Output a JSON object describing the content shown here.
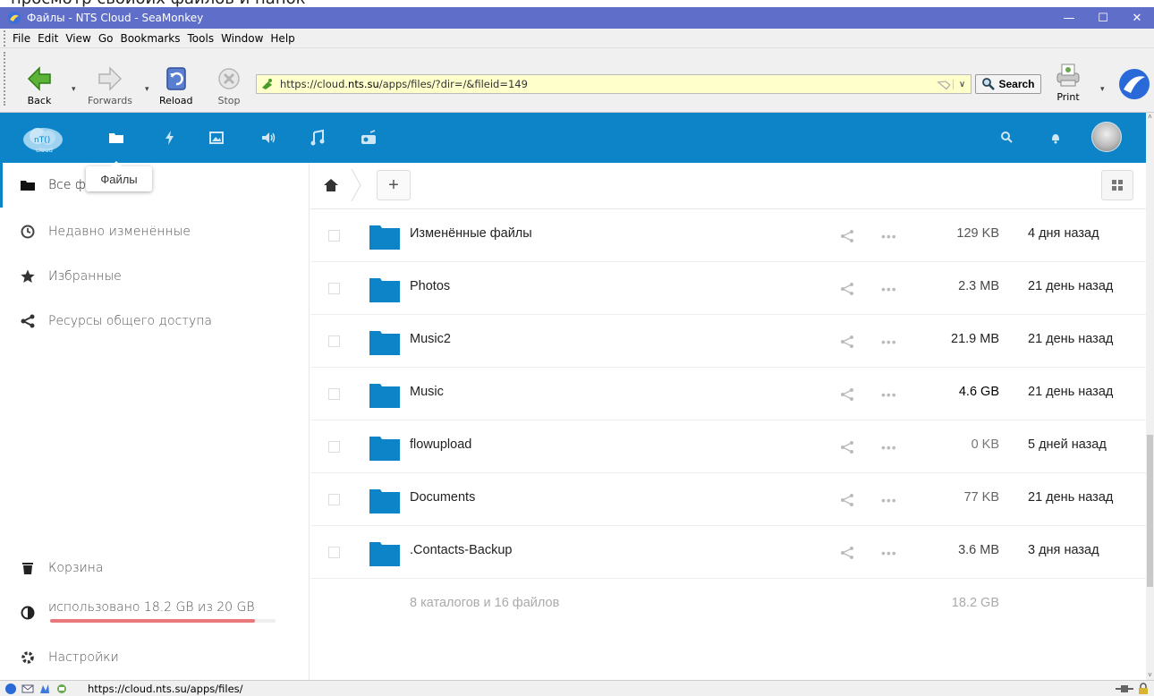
{
  "caption_top": "просмотр своиоих файлов и папок",
  "window": {
    "title": "Файлы - NTS Cloud - SeaMonkey",
    "minimize": "—",
    "maximize": "☐",
    "close": "✕"
  },
  "menu": [
    "File",
    "Edit",
    "View",
    "Go",
    "Bookmarks",
    "Tools",
    "Window",
    "Help"
  ],
  "toolbar": {
    "back": "Back",
    "forwards": "Forwards",
    "reload": "Reload",
    "stop": "Stop",
    "url_prefix": "https://cloud.",
    "url_domain": "nts.su",
    "url_suffix": "/apps/files/?dir=/&fileid=149",
    "search": "Search",
    "print": "Print"
  },
  "app": {
    "logo_text": "cloud",
    "tooltip": "Файлы"
  },
  "sidebar": {
    "items": [
      {
        "label": "Все файлы",
        "icon": "folder-icon"
      },
      {
        "label": "Недавно изменённые",
        "icon": "clock-icon"
      },
      {
        "label": "Избранные",
        "icon": "star-icon"
      },
      {
        "label": "Ресурсы общего доступа",
        "icon": "share-icon"
      }
    ],
    "trash": "Корзина",
    "quota": "использовано 18.2 GB из 20 GB",
    "quota_fraction": 0.91,
    "settings": "Настройки"
  },
  "files": [
    {
      "name": "Изменённые файлы",
      "size": "129 KB",
      "date": "4 дня назад",
      "size_color": "#555555"
    },
    {
      "name": "Photos",
      "size": "2.3 MB",
      "date": "21 день назад",
      "size_color": "#444444"
    },
    {
      "name": "Music2",
      "size": "21.9 MB",
      "date": "21 день назад",
      "size_color": "#222222"
    },
    {
      "name": "Music",
      "size": "4.6 GB",
      "date": "21 день назад",
      "size_color": "#000000"
    },
    {
      "name": "flowupload",
      "size": "0 KB",
      "date": "5 дней назад",
      "size_color": "#777777"
    },
    {
      "name": "Documents",
      "size": "77 KB",
      "date": "21 день назад",
      "size_color": "#666666"
    },
    {
      "name": ".Contacts-Backup",
      "size": "3.6 MB",
      "date": "3 дня назад",
      "size_color": "#444444"
    }
  ],
  "summary": {
    "text": "8 каталогов и 16 файлов",
    "size": "18.2 GB"
  },
  "status": {
    "url": "https://cloud.nts.su/apps/files/"
  },
  "colors": {
    "titlebar": "#5f6ec8",
    "app_header": "#0d84c7",
    "folder": "#0d84c7",
    "quota_fill": "#e9787c"
  }
}
